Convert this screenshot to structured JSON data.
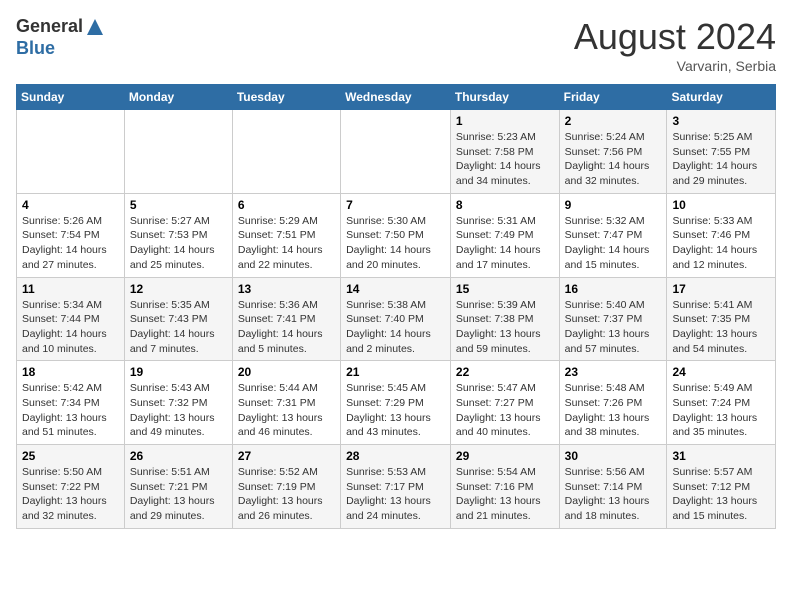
{
  "header": {
    "logo_general": "General",
    "logo_blue": "Blue",
    "month_year": "August 2024",
    "location": "Varvarin, Serbia"
  },
  "weekdays": [
    "Sunday",
    "Monday",
    "Tuesday",
    "Wednesday",
    "Thursday",
    "Friday",
    "Saturday"
  ],
  "weeks": [
    [
      {
        "day": "",
        "info": ""
      },
      {
        "day": "",
        "info": ""
      },
      {
        "day": "",
        "info": ""
      },
      {
        "day": "",
        "info": ""
      },
      {
        "day": "1",
        "info": "Sunrise: 5:23 AM\nSunset: 7:58 PM\nDaylight: 14 hours\nand 34 minutes."
      },
      {
        "day": "2",
        "info": "Sunrise: 5:24 AM\nSunset: 7:56 PM\nDaylight: 14 hours\nand 32 minutes."
      },
      {
        "day": "3",
        "info": "Sunrise: 5:25 AM\nSunset: 7:55 PM\nDaylight: 14 hours\nand 29 minutes."
      }
    ],
    [
      {
        "day": "4",
        "info": "Sunrise: 5:26 AM\nSunset: 7:54 PM\nDaylight: 14 hours\nand 27 minutes."
      },
      {
        "day": "5",
        "info": "Sunrise: 5:27 AM\nSunset: 7:53 PM\nDaylight: 14 hours\nand 25 minutes."
      },
      {
        "day": "6",
        "info": "Sunrise: 5:29 AM\nSunset: 7:51 PM\nDaylight: 14 hours\nand 22 minutes."
      },
      {
        "day": "7",
        "info": "Sunrise: 5:30 AM\nSunset: 7:50 PM\nDaylight: 14 hours\nand 20 minutes."
      },
      {
        "day": "8",
        "info": "Sunrise: 5:31 AM\nSunset: 7:49 PM\nDaylight: 14 hours\nand 17 minutes."
      },
      {
        "day": "9",
        "info": "Sunrise: 5:32 AM\nSunset: 7:47 PM\nDaylight: 14 hours\nand 15 minutes."
      },
      {
        "day": "10",
        "info": "Sunrise: 5:33 AM\nSunset: 7:46 PM\nDaylight: 14 hours\nand 12 minutes."
      }
    ],
    [
      {
        "day": "11",
        "info": "Sunrise: 5:34 AM\nSunset: 7:44 PM\nDaylight: 14 hours\nand 10 minutes."
      },
      {
        "day": "12",
        "info": "Sunrise: 5:35 AM\nSunset: 7:43 PM\nDaylight: 14 hours\nand 7 minutes."
      },
      {
        "day": "13",
        "info": "Sunrise: 5:36 AM\nSunset: 7:41 PM\nDaylight: 14 hours\nand 5 minutes."
      },
      {
        "day": "14",
        "info": "Sunrise: 5:38 AM\nSunset: 7:40 PM\nDaylight: 14 hours\nand 2 minutes."
      },
      {
        "day": "15",
        "info": "Sunrise: 5:39 AM\nSunset: 7:38 PM\nDaylight: 13 hours\nand 59 minutes."
      },
      {
        "day": "16",
        "info": "Sunrise: 5:40 AM\nSunset: 7:37 PM\nDaylight: 13 hours\nand 57 minutes."
      },
      {
        "day": "17",
        "info": "Sunrise: 5:41 AM\nSunset: 7:35 PM\nDaylight: 13 hours\nand 54 minutes."
      }
    ],
    [
      {
        "day": "18",
        "info": "Sunrise: 5:42 AM\nSunset: 7:34 PM\nDaylight: 13 hours\nand 51 minutes."
      },
      {
        "day": "19",
        "info": "Sunrise: 5:43 AM\nSunset: 7:32 PM\nDaylight: 13 hours\nand 49 minutes."
      },
      {
        "day": "20",
        "info": "Sunrise: 5:44 AM\nSunset: 7:31 PM\nDaylight: 13 hours\nand 46 minutes."
      },
      {
        "day": "21",
        "info": "Sunrise: 5:45 AM\nSunset: 7:29 PM\nDaylight: 13 hours\nand 43 minutes."
      },
      {
        "day": "22",
        "info": "Sunrise: 5:47 AM\nSunset: 7:27 PM\nDaylight: 13 hours\nand 40 minutes."
      },
      {
        "day": "23",
        "info": "Sunrise: 5:48 AM\nSunset: 7:26 PM\nDaylight: 13 hours\nand 38 minutes."
      },
      {
        "day": "24",
        "info": "Sunrise: 5:49 AM\nSunset: 7:24 PM\nDaylight: 13 hours\nand 35 minutes."
      }
    ],
    [
      {
        "day": "25",
        "info": "Sunrise: 5:50 AM\nSunset: 7:22 PM\nDaylight: 13 hours\nand 32 minutes."
      },
      {
        "day": "26",
        "info": "Sunrise: 5:51 AM\nSunset: 7:21 PM\nDaylight: 13 hours\nand 29 minutes."
      },
      {
        "day": "27",
        "info": "Sunrise: 5:52 AM\nSunset: 7:19 PM\nDaylight: 13 hours\nand 26 minutes."
      },
      {
        "day": "28",
        "info": "Sunrise: 5:53 AM\nSunset: 7:17 PM\nDaylight: 13 hours\nand 24 minutes."
      },
      {
        "day": "29",
        "info": "Sunrise: 5:54 AM\nSunset: 7:16 PM\nDaylight: 13 hours\nand 21 minutes."
      },
      {
        "day": "30",
        "info": "Sunrise: 5:56 AM\nSunset: 7:14 PM\nDaylight: 13 hours\nand 18 minutes."
      },
      {
        "day": "31",
        "info": "Sunrise: 5:57 AM\nSunset: 7:12 PM\nDaylight: 13 hours\nand 15 minutes."
      }
    ]
  ]
}
